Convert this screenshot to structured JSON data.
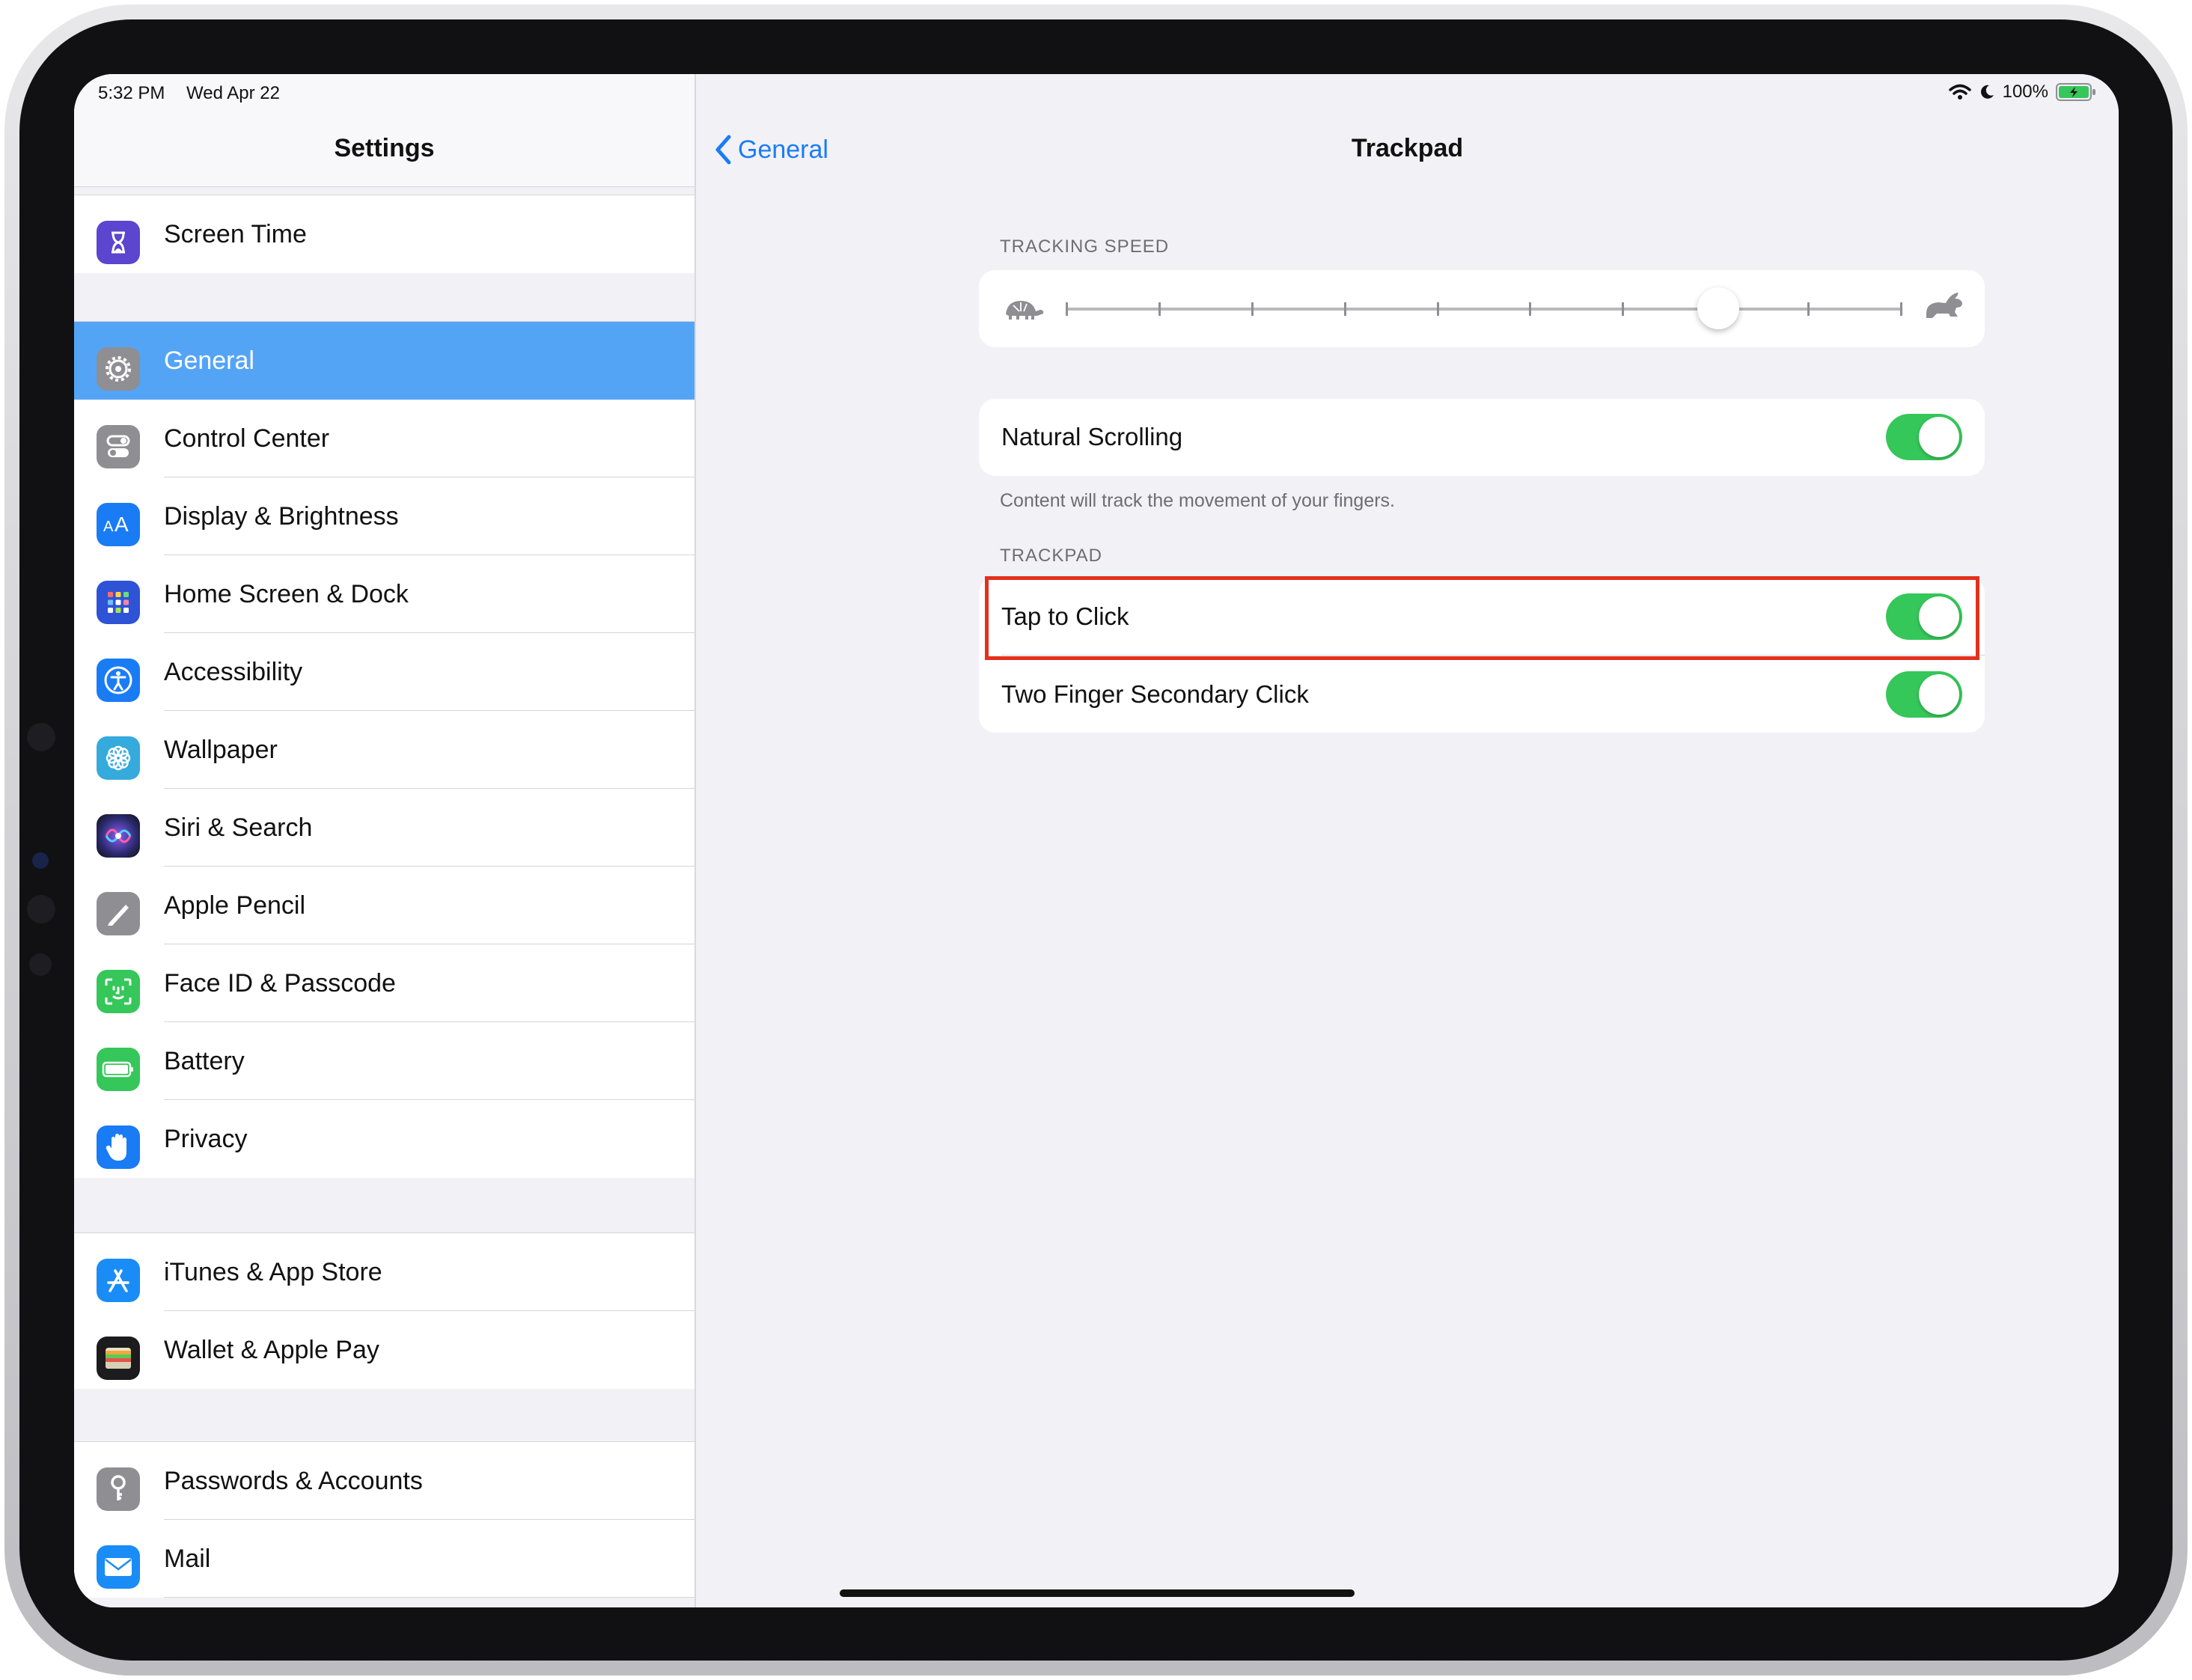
{
  "status_bar": {
    "time": "5:32 PM",
    "date": "Wed Apr 22",
    "battery_text": "100%",
    "icons": [
      "wifi-icon",
      "moon-icon",
      "battery-charging-icon"
    ]
  },
  "sidebar": {
    "title": "Settings",
    "selected_color": "#54a4f6",
    "items": [
      {
        "label": "Screen Time",
        "icon": "hourglass-icon",
        "color": "#5c45cf"
      },
      {
        "label": "General",
        "icon": "gear-icon",
        "color": "#8e8e93",
        "selected": true
      },
      {
        "label": "Control Center",
        "icon": "toggles-icon",
        "color": "#8e8e93"
      },
      {
        "label": "Display & Brightness",
        "icon": "text-size-icon",
        "color": "#1a7cf5"
      },
      {
        "label": "Home Screen & Dock",
        "icon": "app-grid-icon",
        "color": "#2f53d6"
      },
      {
        "label": "Accessibility",
        "icon": "accessibility-icon",
        "color": "#1a7cf5"
      },
      {
        "label": "Wallpaper",
        "icon": "flower-icon",
        "color": "#35aadc"
      },
      {
        "label": "Siri & Search",
        "icon": "siri-icon",
        "color": "#2a2a6e"
      },
      {
        "label": "Apple Pencil",
        "icon": "pencil-icon",
        "color": "#8e8e93"
      },
      {
        "label": "Face ID & Passcode",
        "icon": "face-id-icon",
        "color": "#35c759"
      },
      {
        "label": "Battery",
        "icon": "battery-icon",
        "color": "#35c759"
      },
      {
        "label": "Privacy",
        "icon": "hand-icon",
        "color": "#1a7cf5"
      },
      {
        "label": "iTunes & App Store",
        "icon": "app-store-icon",
        "color": "#1a8cf5"
      },
      {
        "label": "Wallet & Apple Pay",
        "icon": "wallet-icon",
        "color": "#1c1c1e"
      },
      {
        "label": "Passwords & Accounts",
        "icon": "key-icon",
        "color": "#8e8e93"
      },
      {
        "label": "Mail",
        "icon": "envelope-icon",
        "color": "#1a8cf5"
      }
    ]
  },
  "detail": {
    "back_label": "General",
    "title": "Trackpad",
    "tracking_speed": {
      "header": "TRACKING SPEED",
      "tick_count": 10,
      "value_fraction": 0.78,
      "min_icon": "tortoise-icon",
      "max_icon": "hare-icon"
    },
    "natural_scrolling": {
      "label": "Natural Scrolling",
      "on": true,
      "footer": "Content will track the movement of your fingers."
    },
    "trackpad_section": {
      "header": "TRACKPAD",
      "rows": [
        {
          "label": "Tap to Click",
          "on": true,
          "highlighted": true
        },
        {
          "label": "Two Finger Secondary Click",
          "on": true
        }
      ]
    },
    "toggle_color": "#35c759",
    "highlight_color": "#e3311d"
  }
}
